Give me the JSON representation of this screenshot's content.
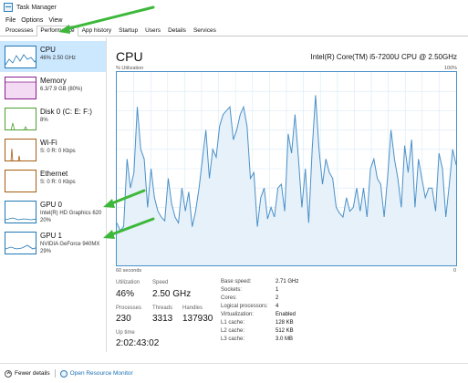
{
  "window": {
    "title": "Task Manager"
  },
  "menu": [
    "File",
    "Options",
    "View"
  ],
  "tabs": [
    "Processes",
    "Performance",
    "App history",
    "Startup",
    "Users",
    "Details",
    "Services"
  ],
  "sidebar": [
    {
      "name": "CPU",
      "sub": "46% 2.50 GHz",
      "color": "#1f77b4"
    },
    {
      "name": "Memory",
      "sub": "6.3/7.9 GB (80%)",
      "color": "#8b1a8b"
    },
    {
      "name": "Disk 0 (C: E: F:)",
      "sub": "8%",
      "color": "#4aa02c"
    },
    {
      "name": "Wi-Fi",
      "sub": "S: 0 R: 0 Kbps",
      "color": "#a85c12"
    },
    {
      "name": "Ethernet",
      "sub": "S: 0 R: 0 Kbps",
      "color": "#a85c12"
    },
    {
      "name": "GPU 0",
      "sub": "Intel(R) HD Graphics 620",
      "sub2": "20%",
      "color": "#1f77b4"
    },
    {
      "name": "GPU 1",
      "sub": "NVIDIA GeForce 940MX",
      "sub2": "29%",
      "color": "#1f77b4"
    }
  ],
  "main": {
    "title": "CPU",
    "model": "Intel(R) Core(TM) i5-7200U CPU @ 2.50GHz",
    "y_label": "% Utilization",
    "y_max_label": "100%",
    "x_left_label": "60 seconds",
    "x_right_label": "0"
  },
  "stats": {
    "utilization_label": "Utilization",
    "utilization": "46%",
    "speed_label": "Speed",
    "speed": "2.50 GHz",
    "processes_label": "Processes",
    "processes": "230",
    "threads_label": "Threads",
    "threads": "3313",
    "handles_label": "Handles",
    "handles": "137930",
    "uptime_label": "Up time",
    "uptime": "2:02:43:02"
  },
  "specs": [
    {
      "label": "Base speed:",
      "value": "2.71 GHz"
    },
    {
      "label": "Sockets:",
      "value": "1"
    },
    {
      "label": "Cores:",
      "value": "2"
    },
    {
      "label": "Logical processors:",
      "value": "4"
    },
    {
      "label": "Virtualization:",
      "value": "Enabled"
    },
    {
      "label": "L1 cache:",
      "value": "128 KB"
    },
    {
      "label": "L2 cache:",
      "value": "512 KB"
    },
    {
      "label": "L3 cache:",
      "value": "3.0 MB"
    }
  ],
  "footer": {
    "fewer_details": "Fewer details",
    "open_monitor": "Open Resource Monitor"
  },
  "chart_data": {
    "type": "area",
    "y_range": [
      0,
      100
    ],
    "x_range_seconds": [
      60,
      0
    ],
    "values": [
      22,
      18,
      20,
      55,
      40,
      48,
      82,
      60,
      55,
      30,
      50,
      35,
      28,
      25,
      23,
      45,
      32,
      25,
      22,
      40,
      28,
      38,
      20,
      28,
      40,
      55,
      70,
      45,
      60,
      56,
      72,
      78,
      80,
      82,
      65,
      70,
      78,
      82,
      72,
      45,
      48,
      20,
      35,
      40,
      24,
      30,
      25,
      40,
      42,
      28,
      68,
      58,
      78,
      55,
      30,
      50,
      22,
      60,
      88,
      60,
      42,
      55,
      48,
      45,
      30,
      27,
      25,
      35,
      28,
      30,
      40,
      28,
      40,
      25,
      50,
      55,
      45,
      42,
      25,
      45,
      70,
      55,
      45,
      30,
      62,
      48,
      65,
      30,
      55,
      45,
      35,
      40,
      40,
      28,
      58,
      50,
      25,
      42,
      60,
      52
    ]
  }
}
